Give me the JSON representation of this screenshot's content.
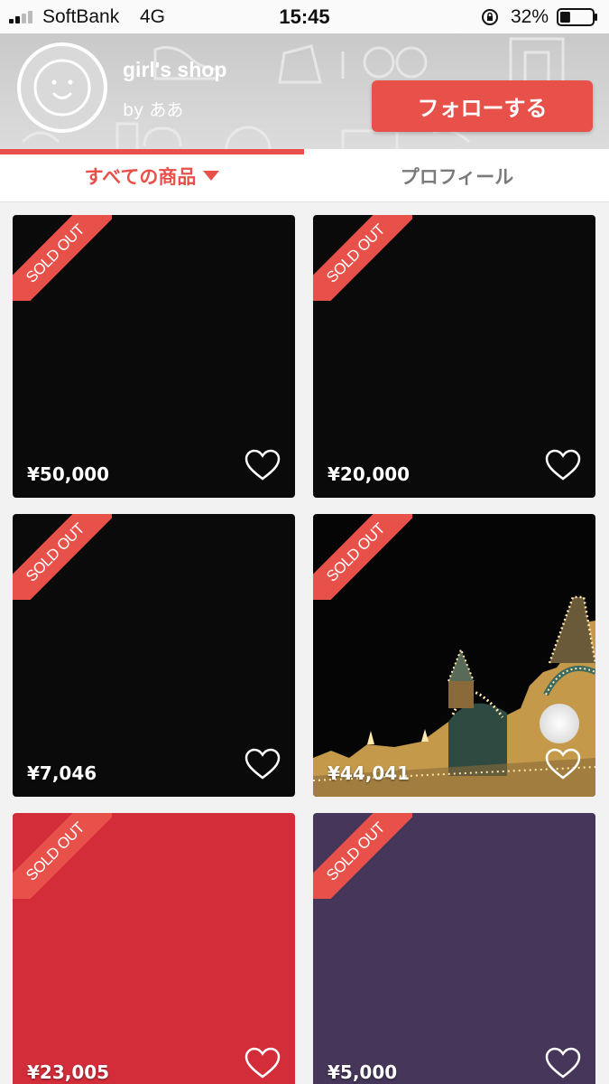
{
  "status_bar": {
    "carrier": "SoftBank",
    "network": "4G",
    "time": "15:45",
    "battery": "32%",
    "battery_level": 0.32
  },
  "shop": {
    "name": "girl's shop",
    "owner": "by ああ",
    "follow_label": "フォローする"
  },
  "tabs": {
    "all_items": "すべての商品",
    "profile": "プロフィール"
  },
  "items": [
    {
      "sold_label": "SOLD OUT",
      "price": "¥50,000",
      "color": "#0a0a0a"
    },
    {
      "sold_label": "SOLD OUT",
      "price": "¥20,000",
      "color": "#0a0a0a"
    },
    {
      "sold_label": "SOLD OUT",
      "price": "¥7,046",
      "color": "#0a0a0a"
    },
    {
      "sold_label": "SOLD OUT",
      "price": "¥44,041",
      "color": "#050505"
    },
    {
      "sold_label": "SOLD OUT",
      "price": "¥23,005",
      "color": "#d42d3a"
    },
    {
      "sold_label": "SOLD OUT",
      "price": "¥5,000",
      "color": "#46365a"
    }
  ],
  "colors": {
    "accent": "#e8514a"
  }
}
